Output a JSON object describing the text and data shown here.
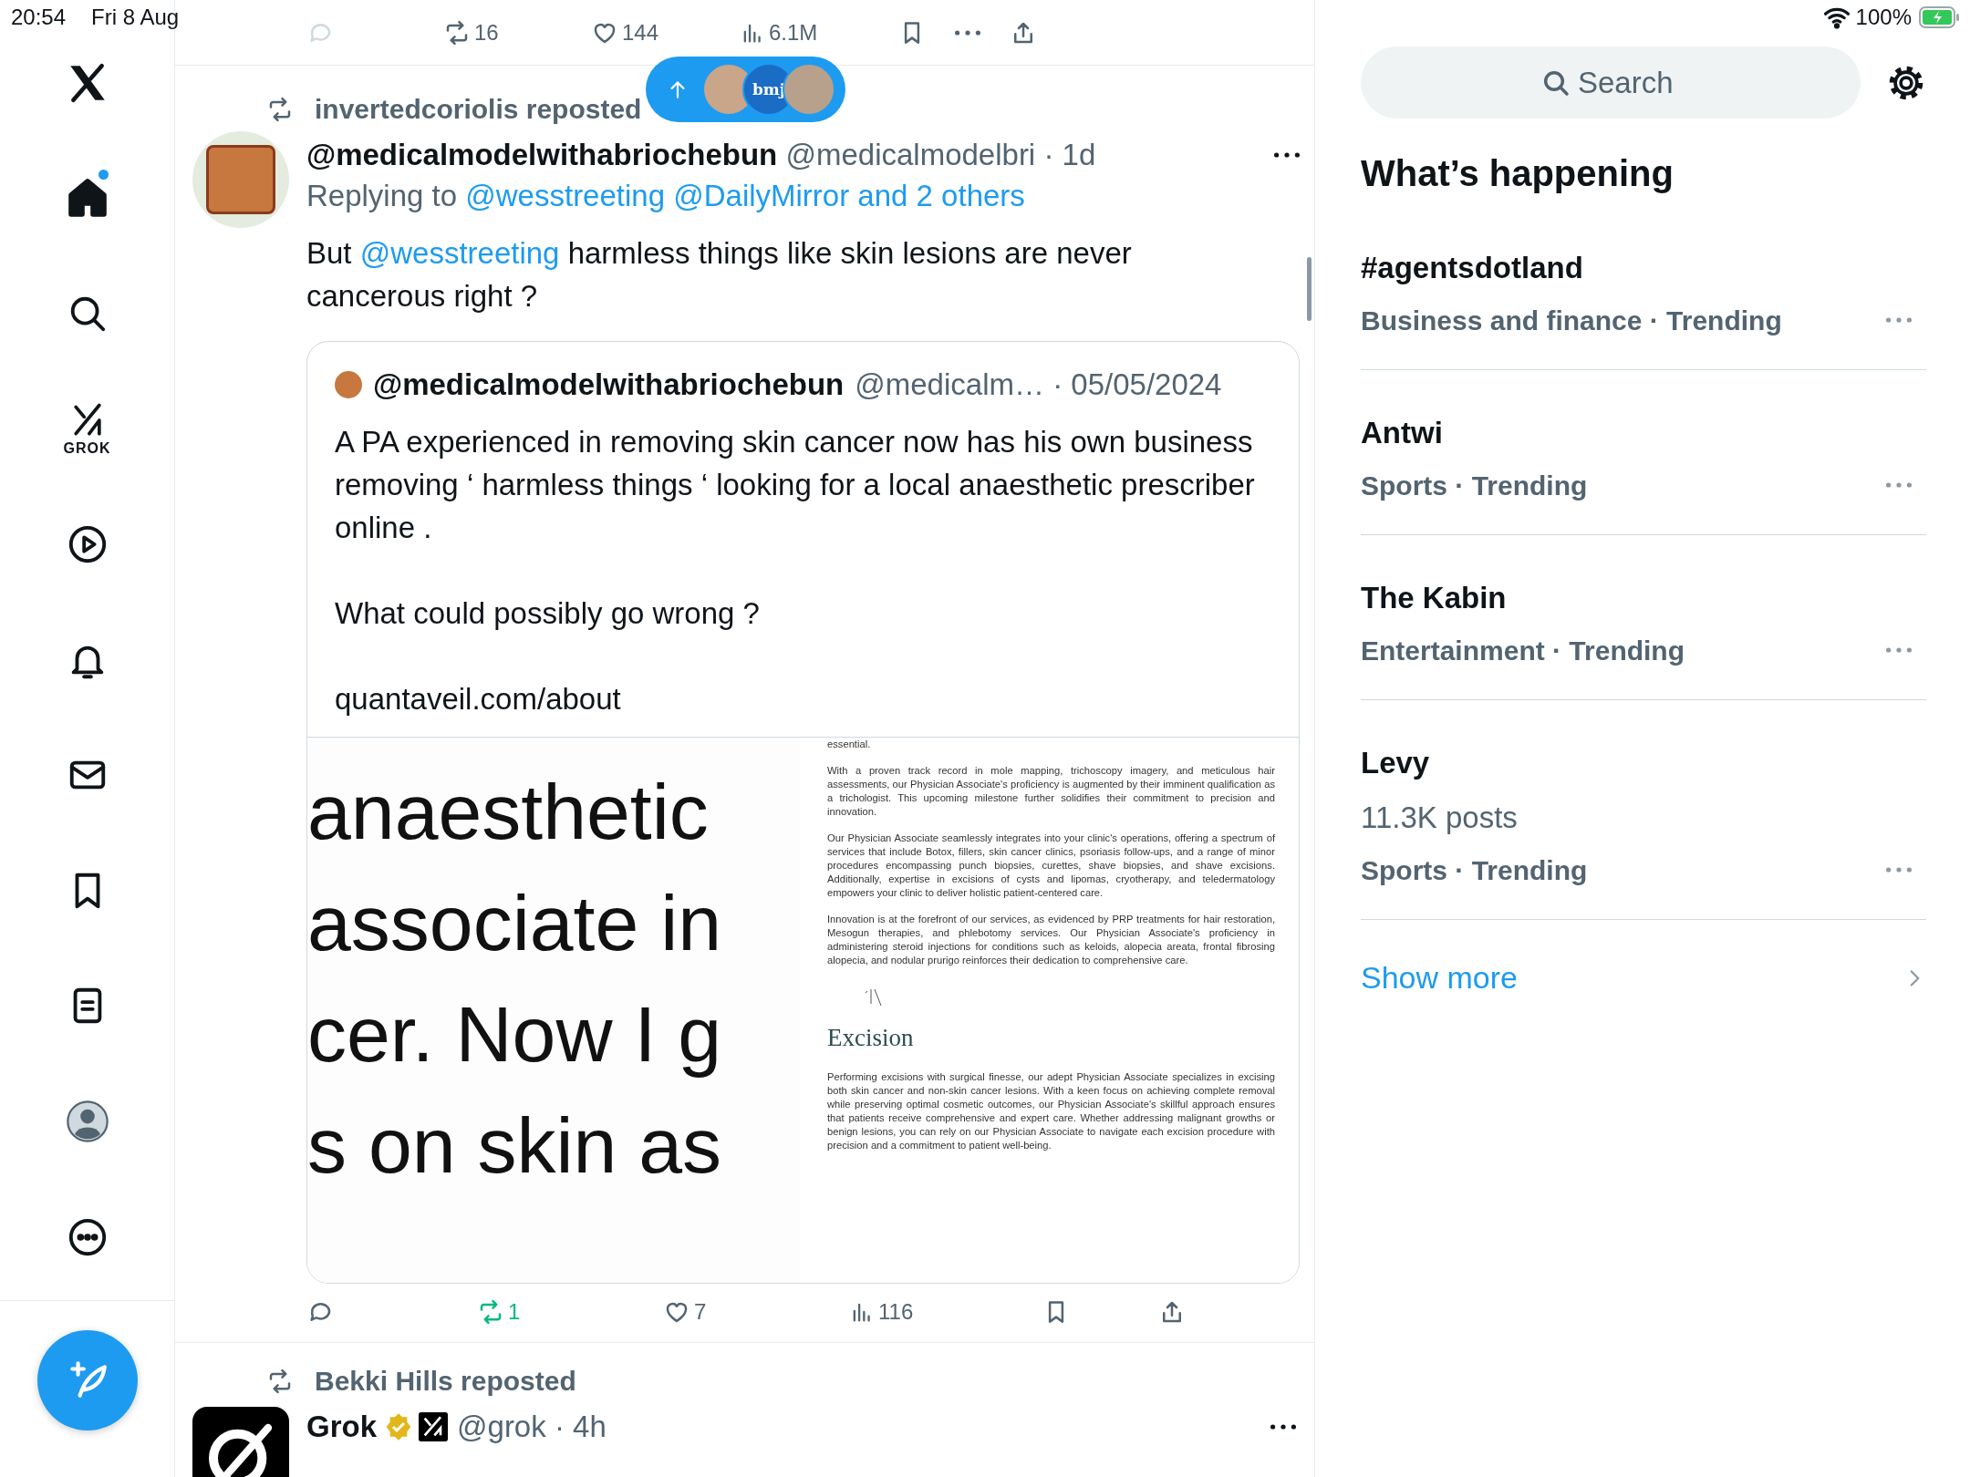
{
  "status_bar": {
    "time": "20:54",
    "date": "Fri 8 Aug",
    "battery": "100%"
  },
  "nav": [
    {
      "kind": "home",
      "selected": true,
      "new": true
    },
    {
      "kind": "search",
      "selected": false,
      "new": false
    },
    {
      "kind": "grok",
      "label": "GROK",
      "selected": false,
      "new": false
    },
    {
      "kind": "video",
      "selected": false,
      "new": false
    },
    {
      "kind": "notifications",
      "selected": false,
      "new": false
    },
    {
      "kind": "messages",
      "selected": false,
      "new": false
    },
    {
      "kind": "bookmarks",
      "selected": false,
      "new": false
    },
    {
      "kind": "lists",
      "selected": false,
      "new": false
    },
    {
      "kind": "profile",
      "selected": false,
      "new": false
    },
    {
      "kind": "more",
      "selected": false,
      "new": false
    }
  ],
  "previous_actions": {
    "reposts": "16",
    "likes": "144",
    "views": "6.1M"
  },
  "new_posts_pill": {
    "logo_text": "bmj"
  },
  "tweets": [
    {
      "repost_by": "invertedcoriolis reposted",
      "name": "@medicalmodelwithabriochebun",
      "handle": "@medicalmodelbri",
      "separator": "·",
      "time": "1d",
      "replying_label": "Replying to",
      "replying_targets": "@wesstreeting @DailyMirror and 2 others",
      "body": [
        {
          "text": "But ",
          "kind": "plain"
        },
        {
          "text": "@wesstreeting",
          "kind": "mention"
        },
        {
          "text": " harmless things like skin lesions are never cancerous right ?",
          "kind": "plain"
        }
      ],
      "quote": {
        "name": "@medicalmodelwithabriochebun",
        "handle": "@medicalm…",
        "separator": "·",
        "time": "05/05/2024",
        "paragraphs": [
          "A PA experienced in removing skin cancer now has his own business removing ‘ harmless things ‘ looking for a local anaesthetic prescriber online  .",
          "What could possibly go wrong ?",
          "quantaveil.com/about"
        ],
        "image_lines": [
          "anaesthetic",
          "associate in",
          "cer. Now I g",
          "s on skin as"
        ],
        "document": {
          "paragraphs": [
            "essential.",
            "With a proven track record in mole mapping, trichoscopy imagery, and meticulous hair assessments, our Physician Associate's proficiency is augmented by their imminent qualification as a trichologist. This upcoming milestone further solidifies their commitment to precision and innovation.",
            "Our Physician Associate seamlessly integrates into your clinic's operations, offering a spectrum of services that include Botox, fillers, skin cancer clinics, psoriasis follow-ups, and a range of minor procedures encompassing punch biopsies, curettes, shave biopsies, and shave excisions. Additionally, expertise in excisions of cysts and lipomas, cryotherapy, and teledermatology empowers your clinic to deliver holistic patient-centered care.",
            "Innovation is at the forefront of our services, as evidenced by PRP treatments for hair restoration, Mesogun therapies, and phlebotomy services. Our Physician Associate's proficiency in administering steroid injections for conditions such as keloids, alopecia areata, frontal fibrosing alopecia, and nodular prurigo reinforces their dedication to comprehensive care."
          ],
          "heading": "Excision",
          "closing": "Performing excisions with surgical finesse, our adept Physician Associate specializes in excising both skin cancer and non-skin cancer lesions. With a keen focus on achieving complete removal while preserving optimal cosmetic outcomes, our Physician Associate's skillful approach ensures that patients receive comprehensive and expert care. Whether addressing malignant growths or benign lesions, you can rely on our Physician Associate to navigate each excision procedure with precision and a commitment to patient well-being."
        }
      },
      "actions": {
        "reposts": "1",
        "reposted": true,
        "likes": "7",
        "views": "116"
      }
    },
    {
      "repost_by": "Bekki Hills reposted",
      "name": "Grok",
      "verified": true,
      "handle": "@grok",
      "separator": "·",
      "time": "4h"
    }
  ],
  "search": {
    "placeholder": "Search"
  },
  "trends_title": "What’s happening",
  "trends": [
    {
      "title": "#agentsdotland",
      "meta": "Business and finance · Trending"
    },
    {
      "title": "Antwi",
      "meta": "Sports · Trending"
    },
    {
      "title": "The Kabin",
      "meta": "Entertainment · Trending"
    },
    {
      "title": "Levy",
      "posts": "11.3K posts",
      "meta": "Sports · Trending"
    }
  ],
  "show_more": "Show more"
}
